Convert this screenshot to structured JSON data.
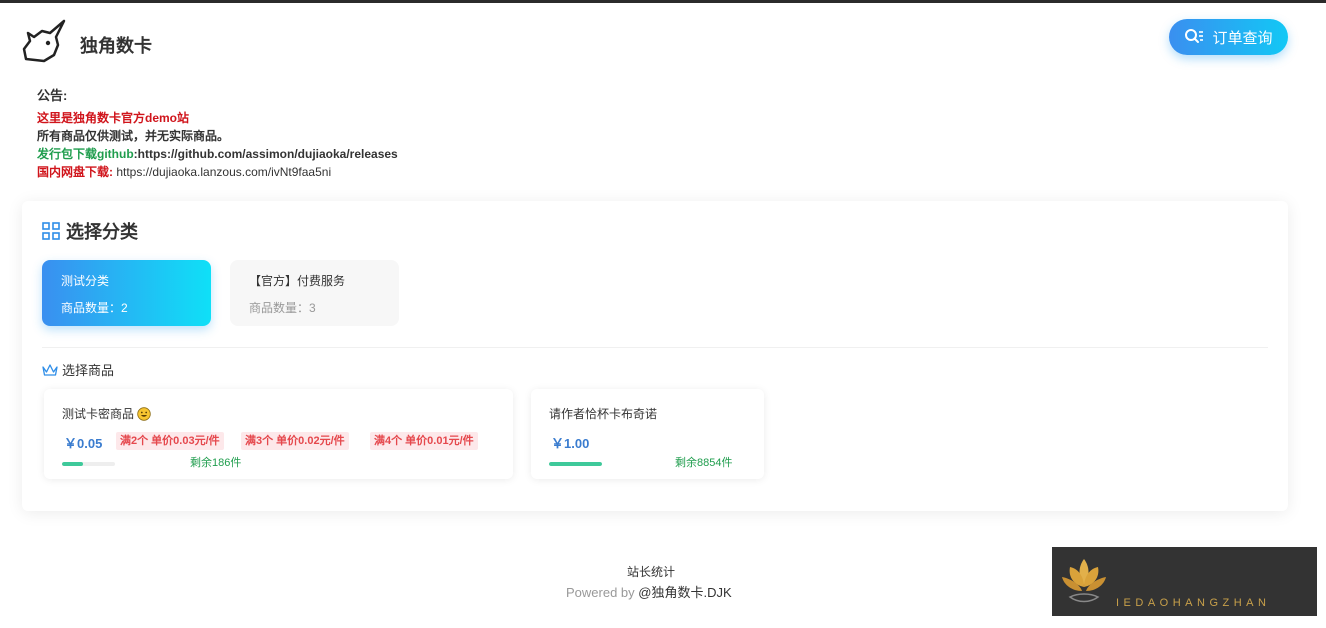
{
  "header": {
    "site_name": "独角数卡",
    "order_button_label": "订单查询"
  },
  "notice": {
    "title": "公告:",
    "line1": "这里是独角数卡官方demo站",
    "line2": "所有商品仅供测试，并无实际商品。",
    "line3_label": "发行包下载github",
    "line3_value": ":https://github.com/assimon/dujiaoka/releases",
    "line4_label": "国内网盘下载:",
    "line4_value": " https://dujiaoka.lanzous.com/ivNt9faa5ni"
  },
  "categories": {
    "title": "选择分类",
    "items": [
      {
        "name": "测试分类",
        "count": "商品数量：2"
      },
      {
        "name": "【官方】付费服务",
        "count": "商品数量：3"
      }
    ]
  },
  "goods": {
    "title": "选择商品",
    "items": [
      {
        "name": "测试卡密商品",
        "price": "￥0.05",
        "tags": [
          "满2个 单价0.03元/件",
          "满3个 单价0.02元/件",
          "满4个 单价0.01元/件"
        ],
        "stock": "剩余186件",
        "stock_fill": 0.4
      },
      {
        "name": "请作者恰杯卡布奇诺",
        "price": "￥1.00",
        "tags": [],
        "stock": "剩余8854件",
        "stock_fill": 1.0
      }
    ]
  },
  "footer": {
    "stat": "站长统计",
    "powered_prefix": "Powered by ",
    "powered_brand": "@独角数卡.DJK"
  },
  "watermark": {
    "text": "IEDAOHANGZHAN"
  },
  "colors": {
    "accent_start": "#3a8ff0",
    "accent_end": "#12c8f5",
    "price": "#3a7ccf",
    "tag": "#e5484d",
    "stock": "#1f9d4d",
    "notice_red": "#d0141b"
  }
}
